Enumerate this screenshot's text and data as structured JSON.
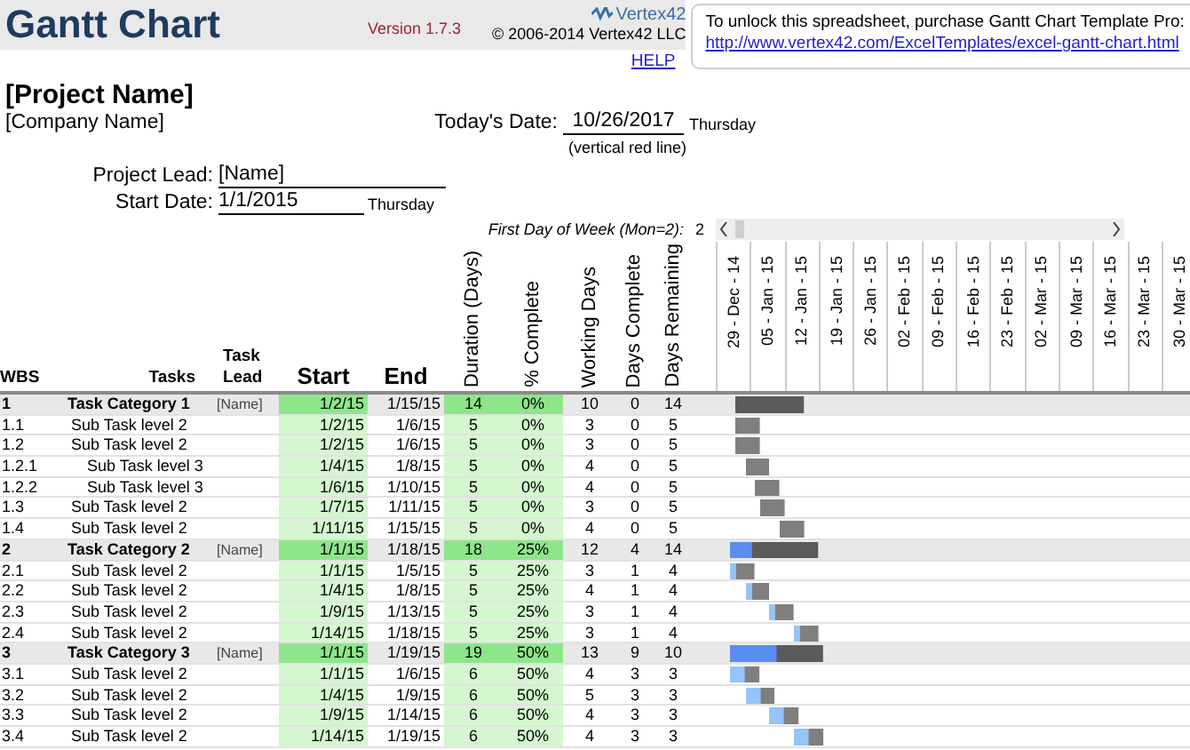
{
  "header": {
    "title": "Gantt Chart",
    "version": "Version 1.7.3",
    "logo": "Vertex42",
    "copyright": "© 2006-2014 Vertex42 LLC",
    "help_link": "HELP"
  },
  "notice": {
    "text": "To unlock this spreadsheet, purchase Gantt Chart Template Pro:",
    "link": "http://www.vertex42.com/ExcelTemplates/excel-gantt-chart.html"
  },
  "project": {
    "name": "[Project Name]",
    "company": "[Company Name]",
    "todays_date_label": "Today's Date:",
    "todays_date": "10/26/2017",
    "todays_day": "Thursday",
    "todays_note": "(vertical red line)",
    "lead_label": "Project Lead:",
    "lead": "[Name]",
    "start_label": "Start Date:",
    "start_date": "1/1/2015",
    "start_day": "Thursday",
    "week_label": "First Day of Week (Mon=2):",
    "week_value": "2"
  },
  "columns": [
    {
      "label": "WBS"
    },
    {
      "label": "Tasks"
    },
    {
      "label": "Task Lead"
    },
    {
      "label": "Start"
    },
    {
      "label": "End"
    },
    {
      "label": "Duration (Days)"
    },
    {
      "label": "% Complete"
    },
    {
      "label": "Working Days"
    },
    {
      "label": "Days Complete"
    },
    {
      "label": "Days Remaining"
    }
  ],
  "weeks": [
    "29 - Dec - 14",
    "05 - Jan - 15",
    "12 - Jan - 15",
    "19 - Jan - 15",
    "26 - Jan - 15",
    "02 - Feb - 15",
    "09 - Feb - 15",
    "16 - Feb - 15",
    "23 - Feb - 15",
    "02 - Mar - 15",
    "09 - Mar - 15",
    "16 - Mar - 15",
    "23 - Mar - 15",
    "30 - Mar - 15"
  ],
  "tasks": [
    {
      "wbs": "1",
      "task": "Task Category 1",
      "lead": "[Name]",
      "start": "1/2/15",
      "end": "1/15/15",
      "duration": "14",
      "percent": "0%",
      "working": "10",
      "done": "0",
      "remaining": "14",
      "children": [
        {
          "wbs": "1.1",
          "task": "Sub Task level 2",
          "start": "1/2/15",
          "end": "1/6/15",
          "duration": "5",
          "percent": "0%",
          "working": "3",
          "done": "0",
          "remaining": "5"
        },
        {
          "wbs": "1.2",
          "task": "Sub Task level 2",
          "start": "1/2/15",
          "end": "1/6/15",
          "duration": "5",
          "percent": "0%",
          "working": "3",
          "done": "0",
          "remaining": "5",
          "children": [
            {
              "wbs": "1.2.1",
              "task": "Sub Task level 3",
              "start": "1/4/15",
              "end": "1/8/15",
              "duration": "5",
              "percent": "0%",
              "working": "4",
              "done": "0",
              "remaining": "5"
            },
            {
              "wbs": "1.2.2",
              "task": "Sub Task level 3",
              "start": "1/6/15",
              "end": "1/10/15",
              "duration": "5",
              "percent": "0%",
              "working": "4",
              "done": "0",
              "remaining": "5"
            }
          ]
        },
        {
          "wbs": "1.3",
          "task": "Sub Task level 2",
          "start": "1/7/15",
          "end": "1/11/15",
          "duration": "5",
          "percent": "0%",
          "working": "3",
          "done": "0",
          "remaining": "5"
        },
        {
          "wbs": "1.4",
          "task": "Sub Task level 2",
          "start": "1/11/15",
          "end": "1/15/15",
          "duration": "5",
          "percent": "0%",
          "working": "4",
          "done": "0",
          "remaining": "5"
        }
      ]
    },
    {
      "wbs": "2",
      "task": "Task Category 2",
      "lead": "[Name]",
      "start": "1/1/15",
      "end": "1/18/15",
      "duration": "18",
      "percent": "25%",
      "working": "12",
      "done": "4",
      "remaining": "14",
      "children": [
        {
          "wbs": "2.1",
          "task": "Sub Task level 2",
          "start": "1/1/15",
          "end": "1/5/15",
          "duration": "5",
          "percent": "25%",
          "working": "3",
          "done": "1",
          "remaining": "4"
        },
        {
          "wbs": "2.2",
          "task": "Sub Task level 2",
          "start": "1/4/15",
          "end": "1/8/15",
          "duration": "5",
          "percent": "25%",
          "working": "4",
          "done": "1",
          "remaining": "4"
        },
        {
          "wbs": "2.3",
          "task": "Sub Task level 2",
          "start": "1/9/15",
          "end": "1/13/15",
          "duration": "5",
          "percent": "25%",
          "working": "3",
          "done": "1",
          "remaining": "4"
        },
        {
          "wbs": "2.4",
          "task": "Sub Task level 2",
          "start": "1/14/15",
          "end": "1/18/15",
          "duration": "5",
          "percent": "25%",
          "working": "3",
          "done": "1",
          "remaining": "4"
        }
      ]
    },
    {
      "wbs": "3",
      "task": "Task Category 3",
      "lead": "[Name]",
      "start": "1/1/15",
      "end": "1/19/15",
      "duration": "19",
      "percent": "50%",
      "working": "13",
      "done": "9",
      "remaining": "10",
      "children": [
        {
          "wbs": "3.1",
          "task": "Sub Task level 2",
          "start": "1/1/15",
          "end": "1/6/15",
          "duration": "6",
          "percent": "50%",
          "working": "4",
          "done": "3",
          "remaining": "3"
        },
        {
          "wbs": "3.2",
          "task": "Sub Task level 2",
          "start": "1/4/15",
          "end": "1/9/15",
          "duration": "6",
          "percent": "50%",
          "working": "5",
          "done": "3",
          "remaining": "3"
        },
        {
          "wbs": "3.3",
          "task": "Sub Task level 2",
          "start": "1/9/15",
          "end": "1/14/15",
          "duration": "6",
          "percent": "50%",
          "working": "4",
          "done": "3",
          "remaining": "3"
        },
        {
          "wbs": "3.4",
          "task": "Sub Task level 2",
          "start": "1/14/15",
          "end": "1/19/15",
          "duration": "6",
          "percent": "50%",
          "working": "4",
          "done": "3",
          "remaining": "3"
        }
      ]
    }
  ]
}
